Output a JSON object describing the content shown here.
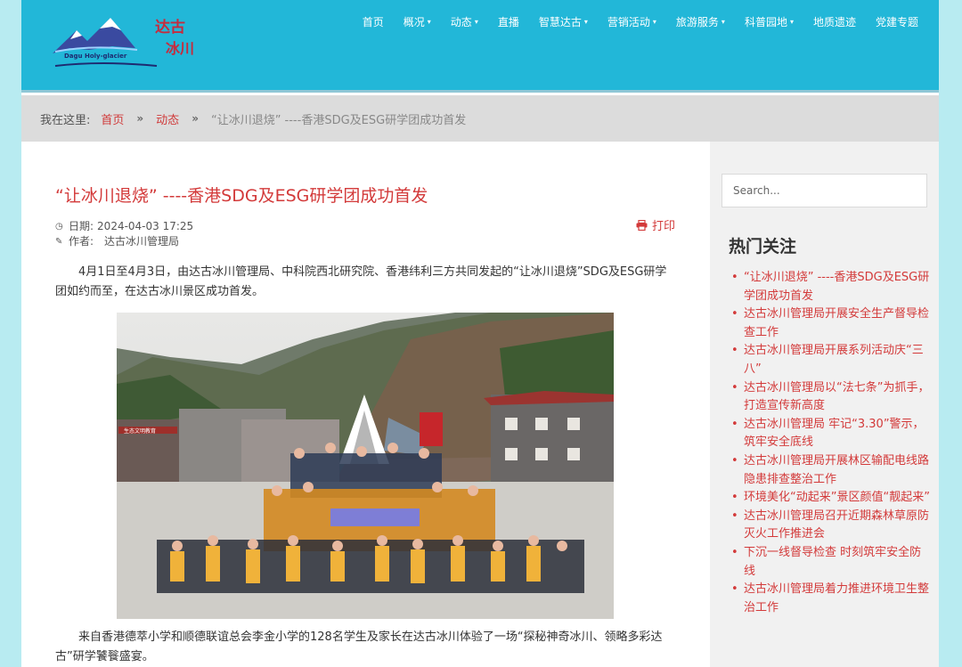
{
  "header": {
    "logo_text": "Dagu Holy-glacier",
    "logo_cn": "达古冰川",
    "nav": [
      {
        "label": "首页",
        "dropdown": false
      },
      {
        "label": "概况",
        "dropdown": true
      },
      {
        "label": "动态",
        "dropdown": true
      },
      {
        "label": "直播",
        "dropdown": false
      },
      {
        "label": "智慧达古",
        "dropdown": true
      },
      {
        "label": "营销活动",
        "dropdown": true
      },
      {
        "label": "旅游服务",
        "dropdown": true
      },
      {
        "label": "科普园地",
        "dropdown": true
      },
      {
        "label": "地质遗迹",
        "dropdown": false
      },
      {
        "label": "党建专题",
        "dropdown": false
      }
    ],
    "chevron": "⌄"
  },
  "breadcrumb": {
    "prefix": "我在这里:",
    "items": [
      "首页",
      "动态"
    ],
    "current": "“让冰川退烧” ----香港SDG及ESG研学团成功首发",
    "separator": "»"
  },
  "article": {
    "title": "“让冰川退烧” ----香港SDG及ESG研学团成功首发",
    "date_label": "日期:",
    "date": "2024-04-03 17:25",
    "author_label": "作者:",
    "author": "达古冰川管理局",
    "print_label": "打印",
    "para1": "4月1日至4月3日，由达古冰川管理局、中科院西北研究院、香港纬利三方共同发起的“让冰川退烧”SDG及ESG研学团如约而至，在达古冰川景区成功首发。",
    "para2": "来自香港德萃小学和顺德联谊总会李金小学的128名学生及家长在达古冰川体验了一场“探秘神奇冰川、领略多彩达古”研学饕餮盛宴。",
    "photo_sign": "生态文明教育"
  },
  "sidebar": {
    "search_placeholder": "Search...",
    "title": "热门关注",
    "items": [
      "“让冰川退烧” ----香港SDG及ESG研学团成功首发",
      "达古冰川管理局开展安全生产督导检查工作",
      "达古冰川管理局开展系列活动庆“三八”",
      "达古冰川管理局以“法七条”为抓手，打造宣传新高度",
      "达古冰川管理局 牢记“3.30”警示，筑牢安全底线",
      "达古冰川管理局开展林区输配电线路隐患排查整治工作",
      "环境美化“动起来”景区颜值“靓起来”",
      "达古冰川管理局召开近期森林草原防灭火工作推进会",
      "下沉一线督导检查 时刻筑牢安全防线",
      "达古冰川管理局着力推进环境卫生整治工作"
    ]
  },
  "colors": {
    "header": "#22b7d8",
    "accent": "#d33a3a",
    "sidebar_bg": "#f1f1f1",
    "crumb_bg": "#dcdcdc"
  },
  "icons": {
    "date": "clock-icon",
    "author": "pencil-icon",
    "print": "printer-icon"
  }
}
